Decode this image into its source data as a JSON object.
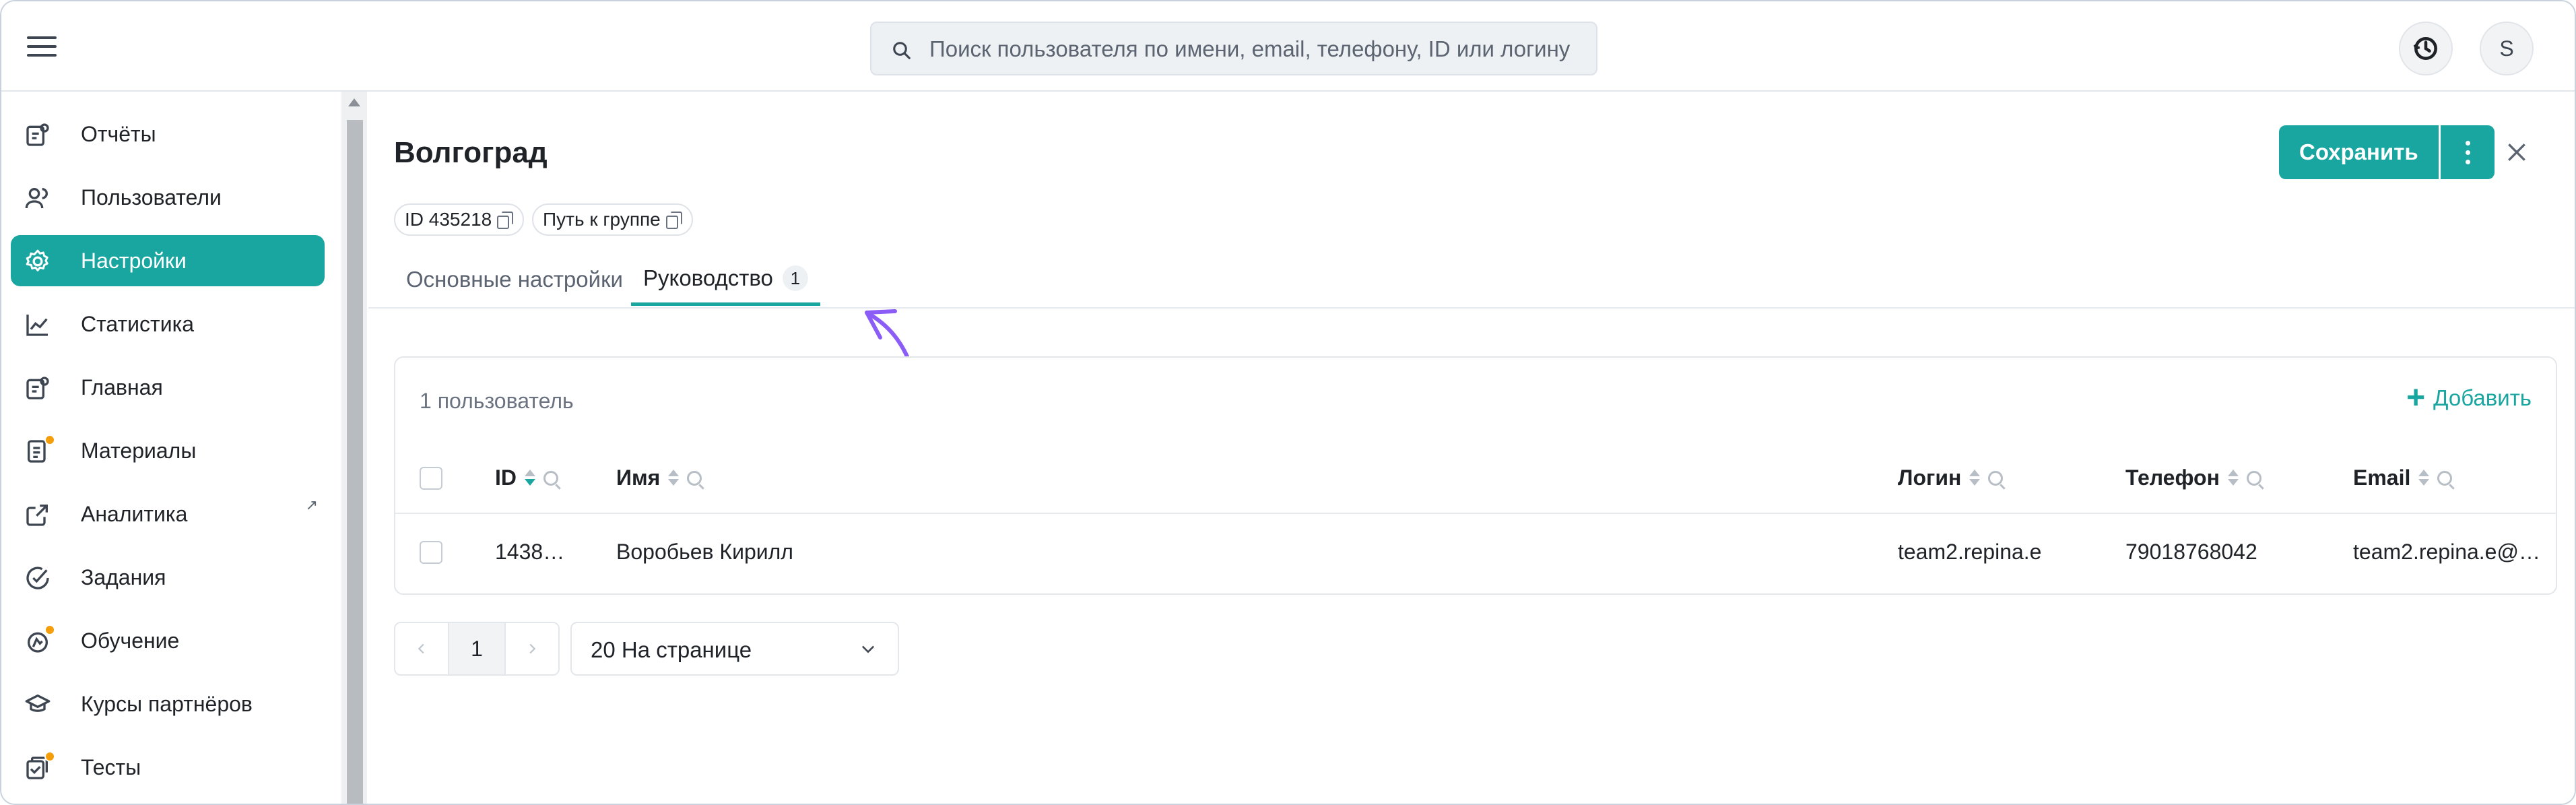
{
  "search": {
    "placeholder": "Поиск пользователя по имени, email, телефону, ID или логину"
  },
  "header": {
    "avatar_letter": "S"
  },
  "sidebar": {
    "items": [
      {
        "label": "Отчёты",
        "icon": "report-icon"
      },
      {
        "label": "Пользователи",
        "icon": "users-icon"
      },
      {
        "label": "Настройки",
        "icon": "gear-icon",
        "active": true
      },
      {
        "label": "Статистика",
        "icon": "chart-line-icon"
      },
      {
        "label": "Главная",
        "icon": "home-doc-icon"
      },
      {
        "label": "Материалы",
        "icon": "materials-icon"
      },
      {
        "label": "Аналитика",
        "icon": "external-link-icon"
      },
      {
        "label": "Задания",
        "icon": "task-check-icon"
      },
      {
        "label": "Обучение",
        "icon": "learning-icon"
      },
      {
        "label": "Курсы партнёров",
        "icon": "graduation-cap-icon"
      },
      {
        "label": "Тесты",
        "icon": "tests-icon"
      }
    ]
  },
  "page": {
    "title": "Волгоград",
    "id_chip": "ID 435218",
    "path_chip": "Путь к группе",
    "save_label": "Сохранить"
  },
  "tabs": [
    {
      "label": "Основные настройки"
    },
    {
      "label": "Руководство",
      "badge": "1",
      "active": true
    }
  ],
  "table": {
    "count_label": "1 пользователь",
    "add_label": "Добавить",
    "columns": [
      "ID",
      "Имя",
      "Логин",
      "Телефон",
      "Email"
    ],
    "rows": [
      {
        "id": "1438…",
        "name": "Воробьев Кирилл",
        "login": "team2.repina.e",
        "phone": "79018768042",
        "email": "team2.repina.e@…"
      }
    ]
  },
  "pagination": {
    "current_page": "1",
    "page_size_label": "20 На странице"
  },
  "colors": {
    "accent": "#1aa6a0",
    "annotation": "#8b5cf6",
    "badge_dot": "#f59e0b"
  }
}
